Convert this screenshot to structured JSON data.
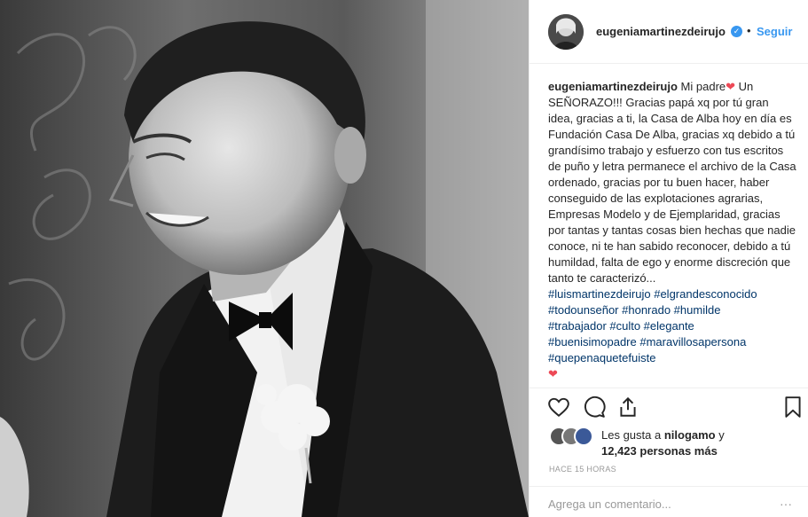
{
  "post": {
    "photo_alt": "",
    "colors": {
      "accent": "#3897f0",
      "heart": "#ed4956",
      "hashtag": "#003569",
      "muted": "#999999"
    }
  },
  "header": {
    "username": "eugeniamartinezdeirujo",
    "verified_icon": "verified-badge-icon",
    "separator": "•",
    "follow_label": "Seguir"
  },
  "caption": {
    "username": "eugeniamartinezdeirujo",
    "text_1": "Mi padre",
    "text_2": "Un SEÑORAZO!!! Gracias papá xq por tú gran idea, gracias a ti, la Casa de Alba hoy en día es Fundación Casa De Alba, gracias xq debido a tú grandísimo trabajo y esfuerzo con tus escritos de puño y letra permanece el archivo de la Casa ordenado, gracias por tu buen hacer, haber conseguido de las explotaciones agrarias, Empresas Modelo y de Ejemplaridad, gracias por tantas y tantas cosas bien hechas que nadie conoce, ni te han sabido reconocer, debido a tú humildad, falta de ego y enorme discreción que tanto te caracterizó...",
    "hashtags": [
      "#luismartinezdeirujo #elgrandesconocido",
      "#todounseñor #honrado #humilde",
      "#trabajador #culto #elegante",
      "#buenisimopadre #maravillosapersona",
      "#quepenaquetefuiste"
    ]
  },
  "actions": {
    "like_icon": "heart-outline-icon",
    "comment_icon": "comment-icon",
    "share_icon": "share-icon",
    "save_icon": "bookmark-icon"
  },
  "likes": {
    "prefix": "Les gusta a",
    "user": "nilogamo",
    "connector": "y",
    "count": "12,423 personas más"
  },
  "timestamp": "HACE 15 HORAS",
  "comment": {
    "placeholder": "Agrega un comentario...",
    "more": "···"
  }
}
